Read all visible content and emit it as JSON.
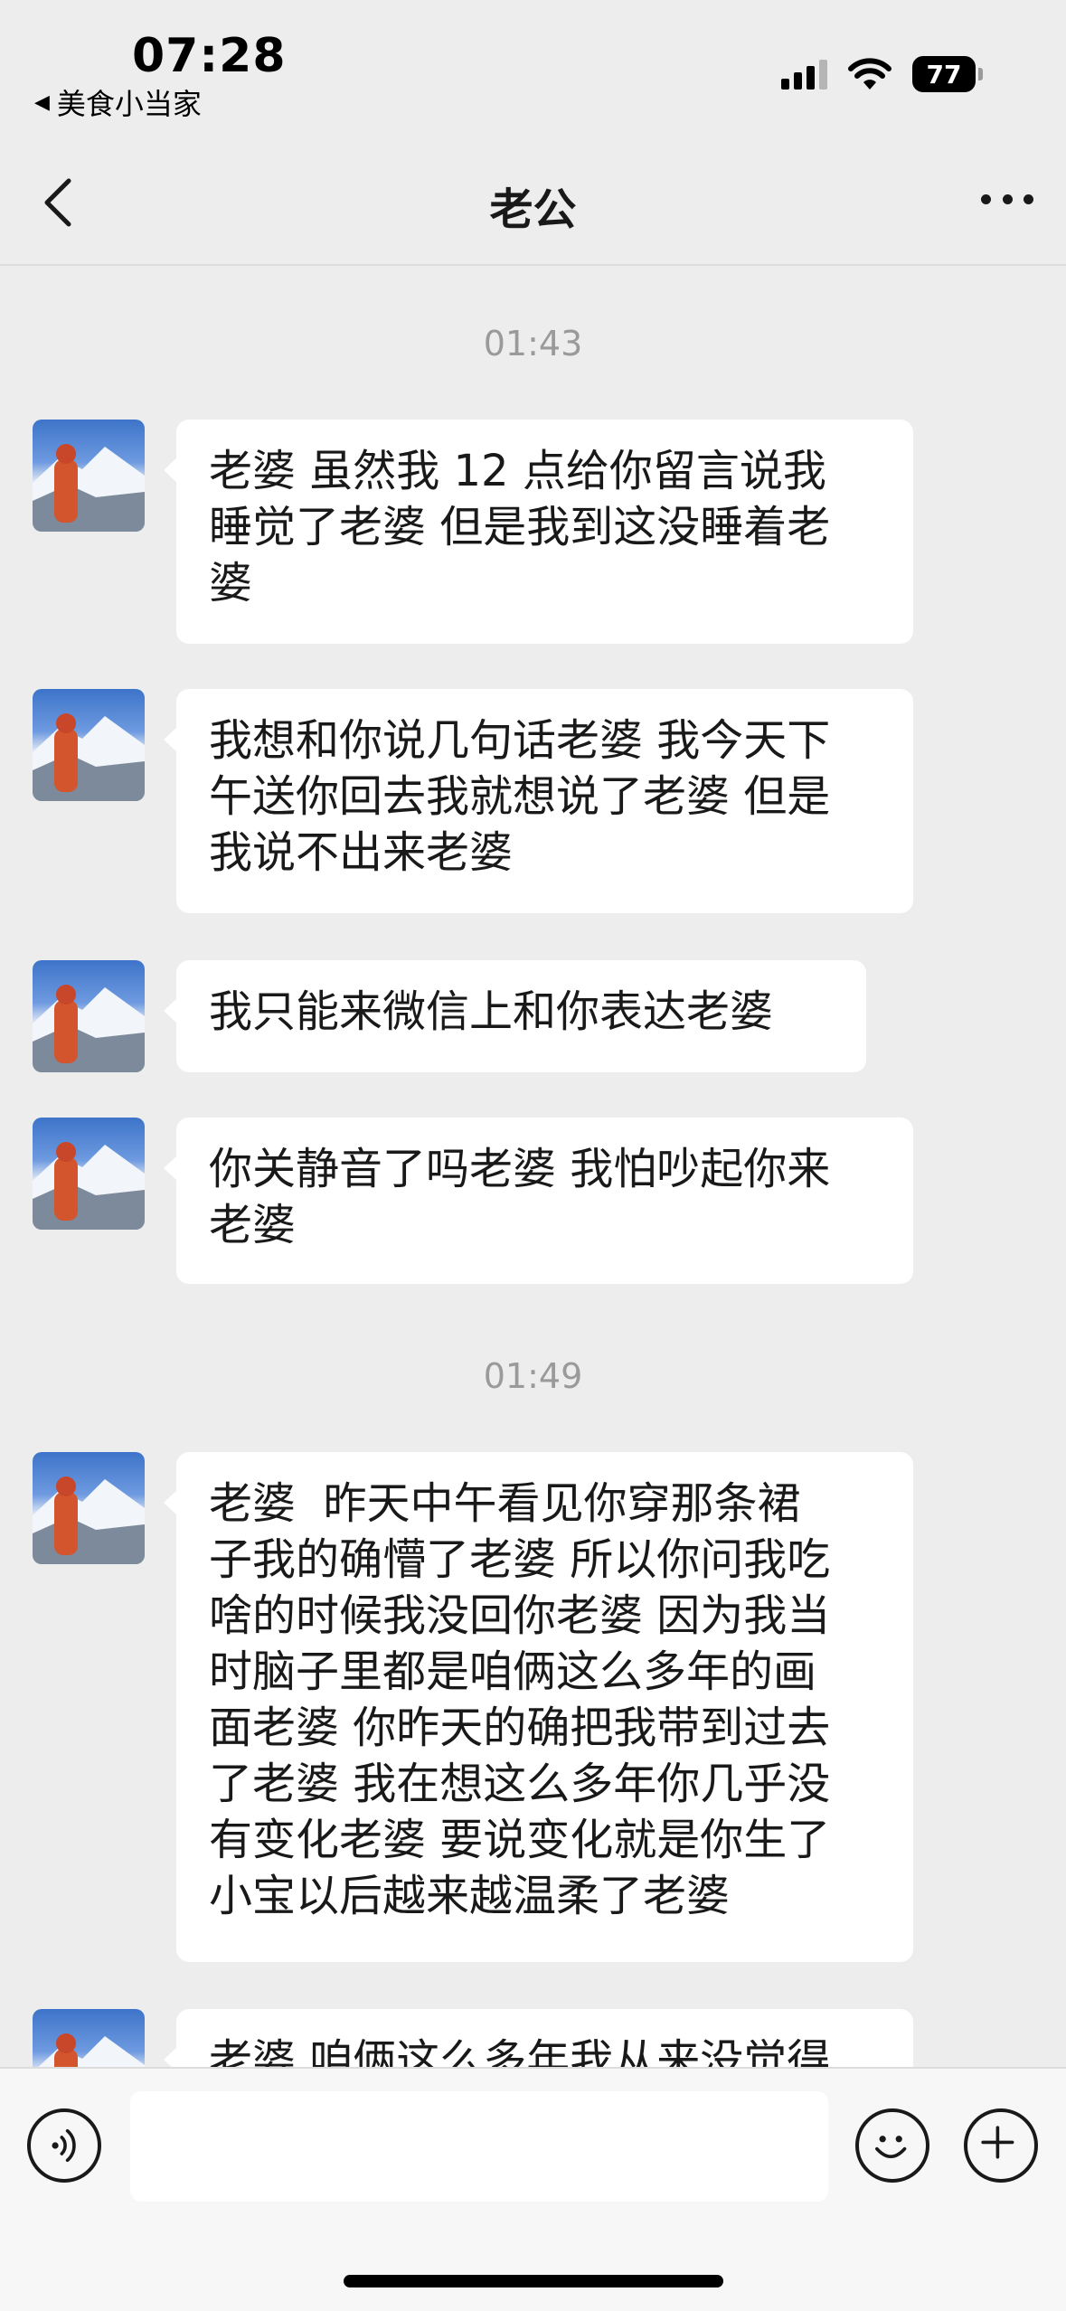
{
  "status_bar": {
    "time": "07:28",
    "back_app": "美食小当家",
    "battery": "77"
  },
  "nav": {
    "title": "老公"
  },
  "chat": {
    "timestamps": [
      "01:43",
      "01:49"
    ],
    "messages": [
      {
        "text": "老婆 虽然我 12 点给你留言说我\n睡觉了老婆 但是我到这没睡着老\n婆"
      },
      {
        "text": "我想和你说几句话老婆 我今天下\n午送你回去我就想说了老婆 但是\n我说不出来老婆"
      },
      {
        "text": "我只能来微信上和你表达老婆"
      },
      {
        "text": "你关静音了吗老婆 我怕吵起你来\n老婆"
      },
      {
        "text": "老婆  昨天中午看见你穿那条裙\n子我的确懵了老婆 所以你问我吃\n啥的时候我没回你老婆 因为我当\n时脑子里都是咱俩这么多年的画\n面老婆 你昨天的确把我带到过去\n了老婆 我在想这么多年你几乎没\n有变化老婆 要说变化就是你生了\n小宝以后越来越温柔了老婆"
      },
      {
        "text": "老婆 咱俩这么多年我从来没觉得"
      }
    ]
  },
  "input": {
    "value": ""
  },
  "icons": {
    "back": "chevron-left-icon",
    "more": "more-dots-icon",
    "voice": "voice-icon",
    "emoji": "emoji-icon",
    "plus": "plus-icon"
  }
}
